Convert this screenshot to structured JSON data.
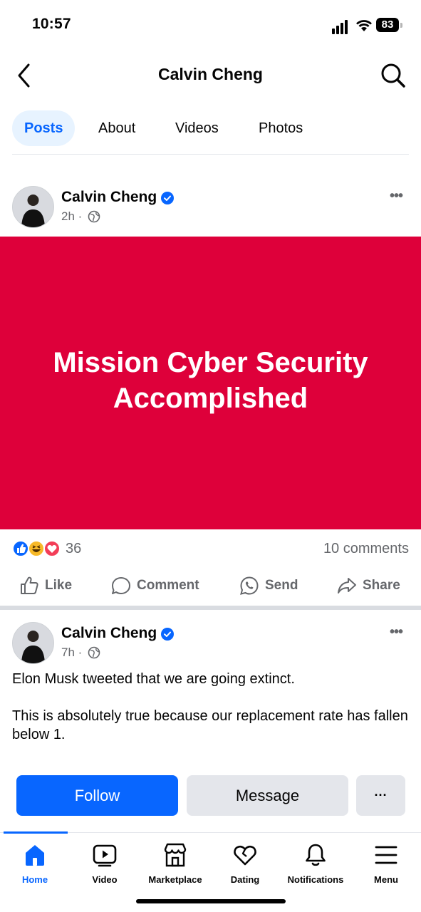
{
  "status_bar": {
    "time": "10:57",
    "battery": "83"
  },
  "header": {
    "title": "Calvin Cheng"
  },
  "tabs": [
    {
      "label": "Posts",
      "active": true
    },
    {
      "label": "About"
    },
    {
      "label": "Videos"
    },
    {
      "label": "Photos"
    }
  ],
  "posts": [
    {
      "author": "Calvin Cheng",
      "time": "2h ·",
      "banner_text_line1": "Mission Cyber Security",
      "banner_text_line2": "Accomplished",
      "banner_color": "#de003a",
      "reaction_count": "36",
      "comments": "10 comments"
    },
    {
      "author": "Calvin Cheng",
      "time": "7h ·",
      "text_para1": "Elon Musk tweeted that we are going extinct.",
      "text_para2": "This is absolutely true because our replacement rate has fallen below 1."
    }
  ],
  "actions": {
    "like": "Like",
    "comment": "Comment",
    "send": "Send",
    "share": "Share"
  },
  "profile_buttons": {
    "follow": "Follow",
    "message": "Message",
    "more": "···"
  },
  "nav": {
    "home": "Home",
    "video": "Video",
    "marketplace": "Marketplace",
    "dating": "Dating",
    "notifications": "Notifications",
    "menu": "Menu"
  },
  "colors": {
    "accent": "#0866ff",
    "banner": "#de003a"
  }
}
